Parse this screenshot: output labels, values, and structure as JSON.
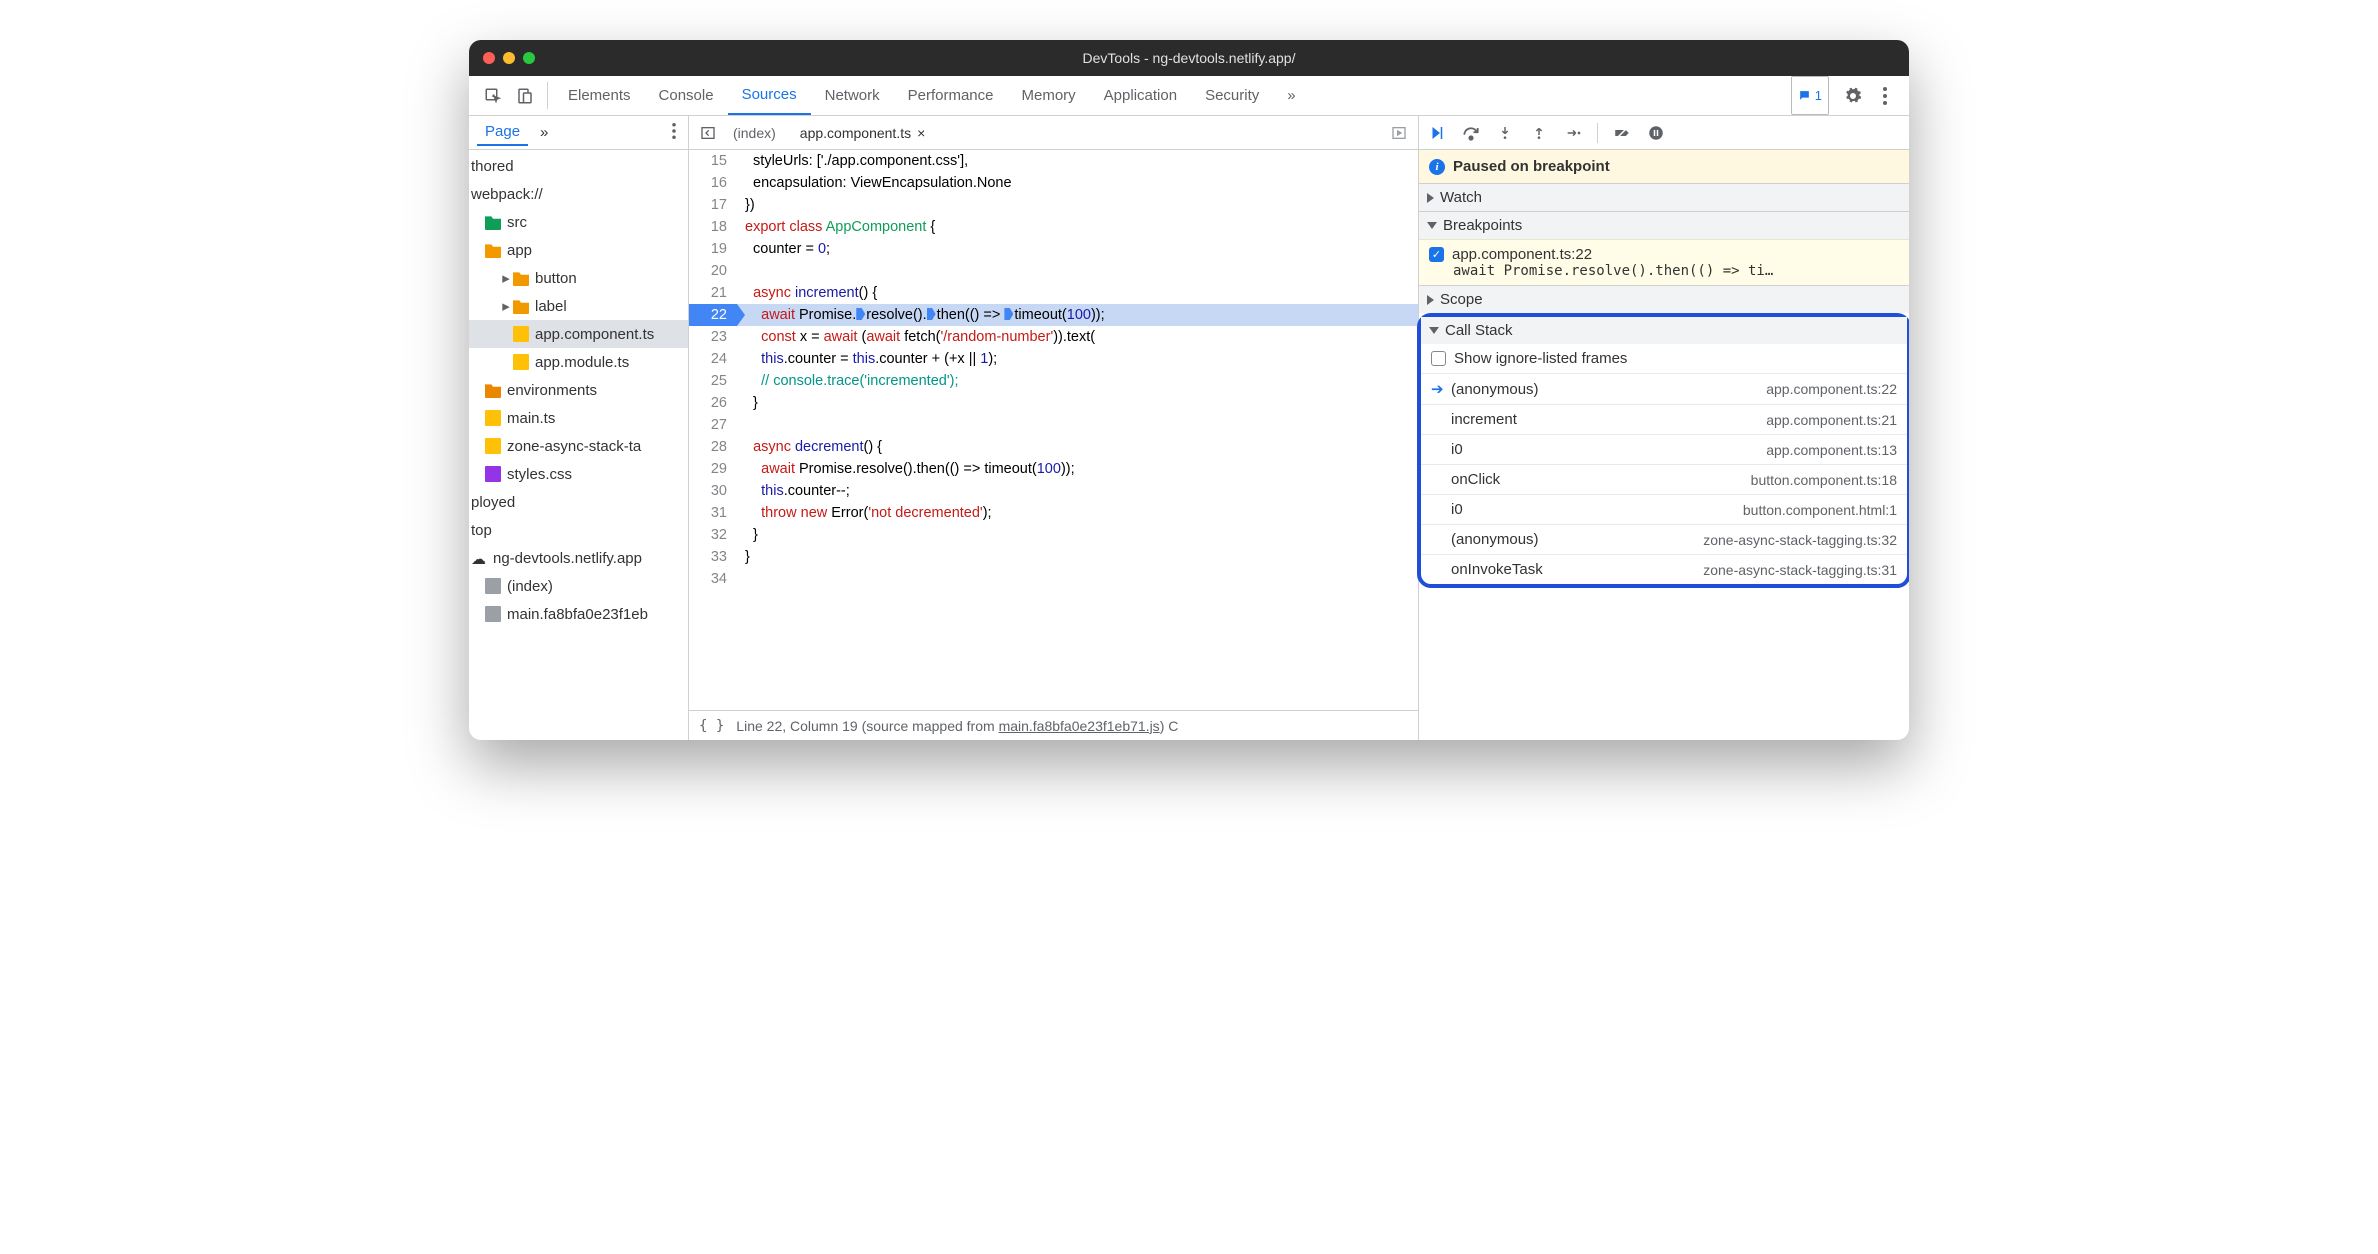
{
  "window": {
    "title": "DevTools - ng-devtools.netlify.app/"
  },
  "toptabs": {
    "items": [
      "Elements",
      "Console",
      "Sources",
      "Network",
      "Performance",
      "Memory",
      "Application",
      "Security"
    ],
    "active": "Sources",
    "overflow": "»",
    "badgeCount": "1"
  },
  "filePane": {
    "tab": "Page",
    "overflow": "»",
    "items": [
      {
        "label": "thored",
        "indent": 0,
        "icon": "",
        "arrow": ""
      },
      {
        "label": "webpack://",
        "indent": 0,
        "icon": "",
        "arrow": ""
      },
      {
        "label": "src",
        "indent": 1,
        "icon": "folder src",
        "arrow": ""
      },
      {
        "label": "app",
        "indent": 1,
        "icon": "folder",
        "arrow": ""
      },
      {
        "label": "button",
        "indent": 2,
        "icon": "folder",
        "arrow": "▸"
      },
      {
        "label": "label",
        "indent": 2,
        "icon": "folder",
        "arrow": "▸"
      },
      {
        "label": "app.component.ts",
        "indent": 2,
        "icon": "file",
        "arrow": "",
        "sel": true
      },
      {
        "label": "app.module.ts",
        "indent": 2,
        "icon": "file",
        "arrow": ""
      },
      {
        "label": "environments",
        "indent": 1,
        "icon": "folder env",
        "arrow": ""
      },
      {
        "label": "main.ts",
        "indent": 1,
        "icon": "file",
        "arrow": ""
      },
      {
        "label": "zone-async-stack-ta",
        "indent": 1,
        "icon": "file",
        "arrow": ""
      },
      {
        "label": "styles.css",
        "indent": 1,
        "icon": "file css",
        "arrow": ""
      },
      {
        "label": "ployed",
        "indent": 0,
        "icon": "",
        "arrow": ""
      },
      {
        "label": "top",
        "indent": 0,
        "icon": "",
        "arrow": ""
      },
      {
        "label": "ng-devtools.netlify.app",
        "indent": 0,
        "icon": "cloud",
        "arrow": ""
      },
      {
        "label": "(index)",
        "indent": 1,
        "icon": "file gray",
        "arrow": ""
      },
      {
        "label": "main.fa8bfa0e23f1eb",
        "indent": 1,
        "icon": "file gray",
        "arrow": ""
      }
    ]
  },
  "editor": {
    "tabs": [
      {
        "label": "(index)",
        "active": false,
        "close": false
      },
      {
        "label": "app.component.ts",
        "active": true,
        "close": true
      }
    ],
    "lines": [
      {
        "n": 15,
        "html": "  styleUrls: ['./app.component.css'],"
      },
      {
        "n": 16,
        "html": "  encapsulation: ViewEncapsulation.None"
      },
      {
        "n": 17,
        "html": "})"
      },
      {
        "n": 18,
        "html": "<span class='kw'>export</span> <span class='kw'>class</span> <span class='cls'>AppComponent</span> {"
      },
      {
        "n": 19,
        "html": "  counter = <span class='num'>0</span>;"
      },
      {
        "n": 20,
        "html": ""
      },
      {
        "n": 21,
        "html": "  <span class='kw'>async</span> <span class='fn'>increment</span>() {"
      },
      {
        "n": 22,
        "hl": true,
        "html": "    <span class='kw'>await</span> Promise.<span class='marker'></span>resolve().<span class='marker'></span>then(() =&gt; <span class='marker'></span>timeout(<span class='num'>100</span>));"
      },
      {
        "n": 23,
        "html": "    <span class='kw'>const</span> x = <span class='kw'>await</span> (<span class='kw'>await</span> fetch(<span class='str'>'/random-number'</span>)).text("
      },
      {
        "n": 24,
        "html": "    <span class='kw2'>this</span>.counter = <span class='kw2'>this</span>.counter + (+x || <span class='num'>1</span>);"
      },
      {
        "n": 25,
        "html": "    <span class='cmt'>// console.trace('incremented');</span>"
      },
      {
        "n": 26,
        "html": "  }"
      },
      {
        "n": 27,
        "html": ""
      },
      {
        "n": 28,
        "html": "  <span class='kw'>async</span> <span class='fn'>decrement</span>() {"
      },
      {
        "n": 29,
        "html": "    <span class='kw'>await</span> Promise.resolve().then(() =&gt; timeout(<span class='num'>100</span>));"
      },
      {
        "n": 30,
        "html": "    <span class='kw2'>this</span>.counter--;"
      },
      {
        "n": 31,
        "html": "    <span class='kw'>throw</span> <span class='kw'>new</span> Error(<span class='str'>'not decremented'</span>);"
      },
      {
        "n": 32,
        "html": "  }"
      },
      {
        "n": 33,
        "html": "}"
      },
      {
        "n": 34,
        "html": ""
      }
    ],
    "status": {
      "pos": "Line 22, Column 19",
      "mapped_prefix": "(source mapped from ",
      "mapped_file": "main.fa8bfa0e23f1eb71.js",
      "mapped_suffix": ") C"
    }
  },
  "debug": {
    "paused": "Paused on breakpoint",
    "watch": "Watch",
    "breakpoints": {
      "title": "Breakpoints",
      "item": {
        "file": "app.component.ts:22",
        "code": "await Promise.resolve().then(() => ti…"
      }
    },
    "scope": "Scope",
    "callstack": {
      "title": "Call Stack",
      "showIgnored": "Show ignore-listed frames",
      "frames": [
        {
          "name": "(anonymous)",
          "loc": "app.component.ts:22",
          "current": true
        },
        {
          "name": "increment",
          "loc": "app.component.ts:21"
        },
        {
          "name": "i0",
          "loc": "app.component.ts:13"
        },
        {
          "name": "onClick",
          "loc": "button.component.ts:18"
        },
        {
          "name": "i0",
          "loc": "button.component.html:1"
        },
        {
          "name": "(anonymous)",
          "loc": "zone-async-stack-tagging.ts:32"
        },
        {
          "name": "onInvokeTask",
          "loc": "zone-async-stack-tagging.ts:31"
        }
      ]
    }
  }
}
